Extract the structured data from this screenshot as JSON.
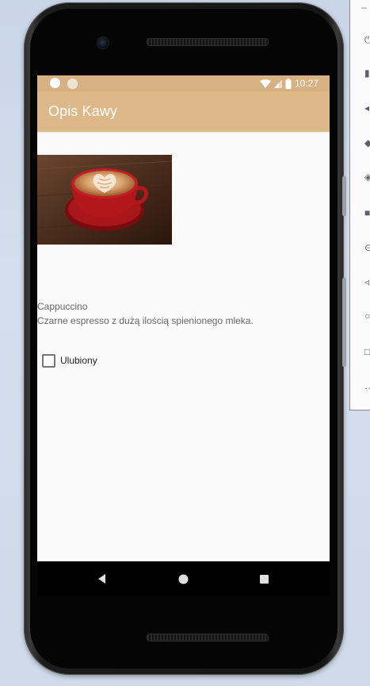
{
  "app": {
    "title": "Opis Kawy"
  },
  "status_bar": {
    "time": "10:27"
  },
  "coffee": {
    "name": "Cappuccino",
    "description": "Czarne espresso z dużą ilością spienionego mleka.",
    "image_icon": "cappuccino-photo"
  },
  "favorite": {
    "label": "Ulubiony",
    "checked": false
  },
  "colors": {
    "status_bar": "#d6b184",
    "app_bar": "#ddb98a",
    "screen_bg": "#fafafa",
    "text_secondary": "#666666"
  },
  "icons": {
    "nav_back": "back-triangle-icon",
    "nav_home": "home-circle-icon",
    "nav_recents": "recents-square-icon",
    "wifi": "wifi-icon",
    "signal": "signal-icon",
    "battery": "battery-icon"
  }
}
